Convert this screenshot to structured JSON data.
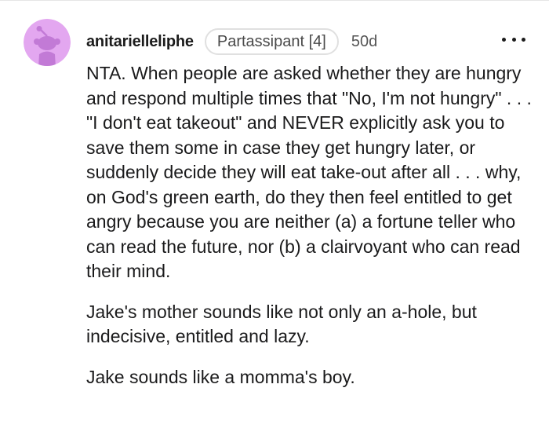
{
  "comment": {
    "avatar_icon": "reddit-snoo-avatar-icon",
    "username": "anitarielleliphe",
    "flair": "Partassipant [4]",
    "age": "50d",
    "more_icon": "more-options-icon",
    "paragraphs": [
      "NTA. When people are asked whether they are hungry and respond multiple times that \"No, I'm not hungry\" . . . \"I don't eat takeout\" and NEVER explicitly ask you to save them some in case they get hungry later, or suddenly decide they will eat take-out after all . . . why, on God's green earth, do they then feel entitled to get angry because you are neither (a) a fortune teller who can read the future, nor (b) a clairvoyant who can read their mind.",
      "Jake's mother sounds like not only an a-hole, but indecisive, entitled and lazy.",
      "Jake sounds like a momma's boy."
    ]
  },
  "colors": {
    "avatar_bg": "#e3a7f0",
    "avatar_figure": "#c27ad6",
    "text": "#1a1a1b",
    "meta": "#555555",
    "flair_border": "#e0e0e0"
  }
}
